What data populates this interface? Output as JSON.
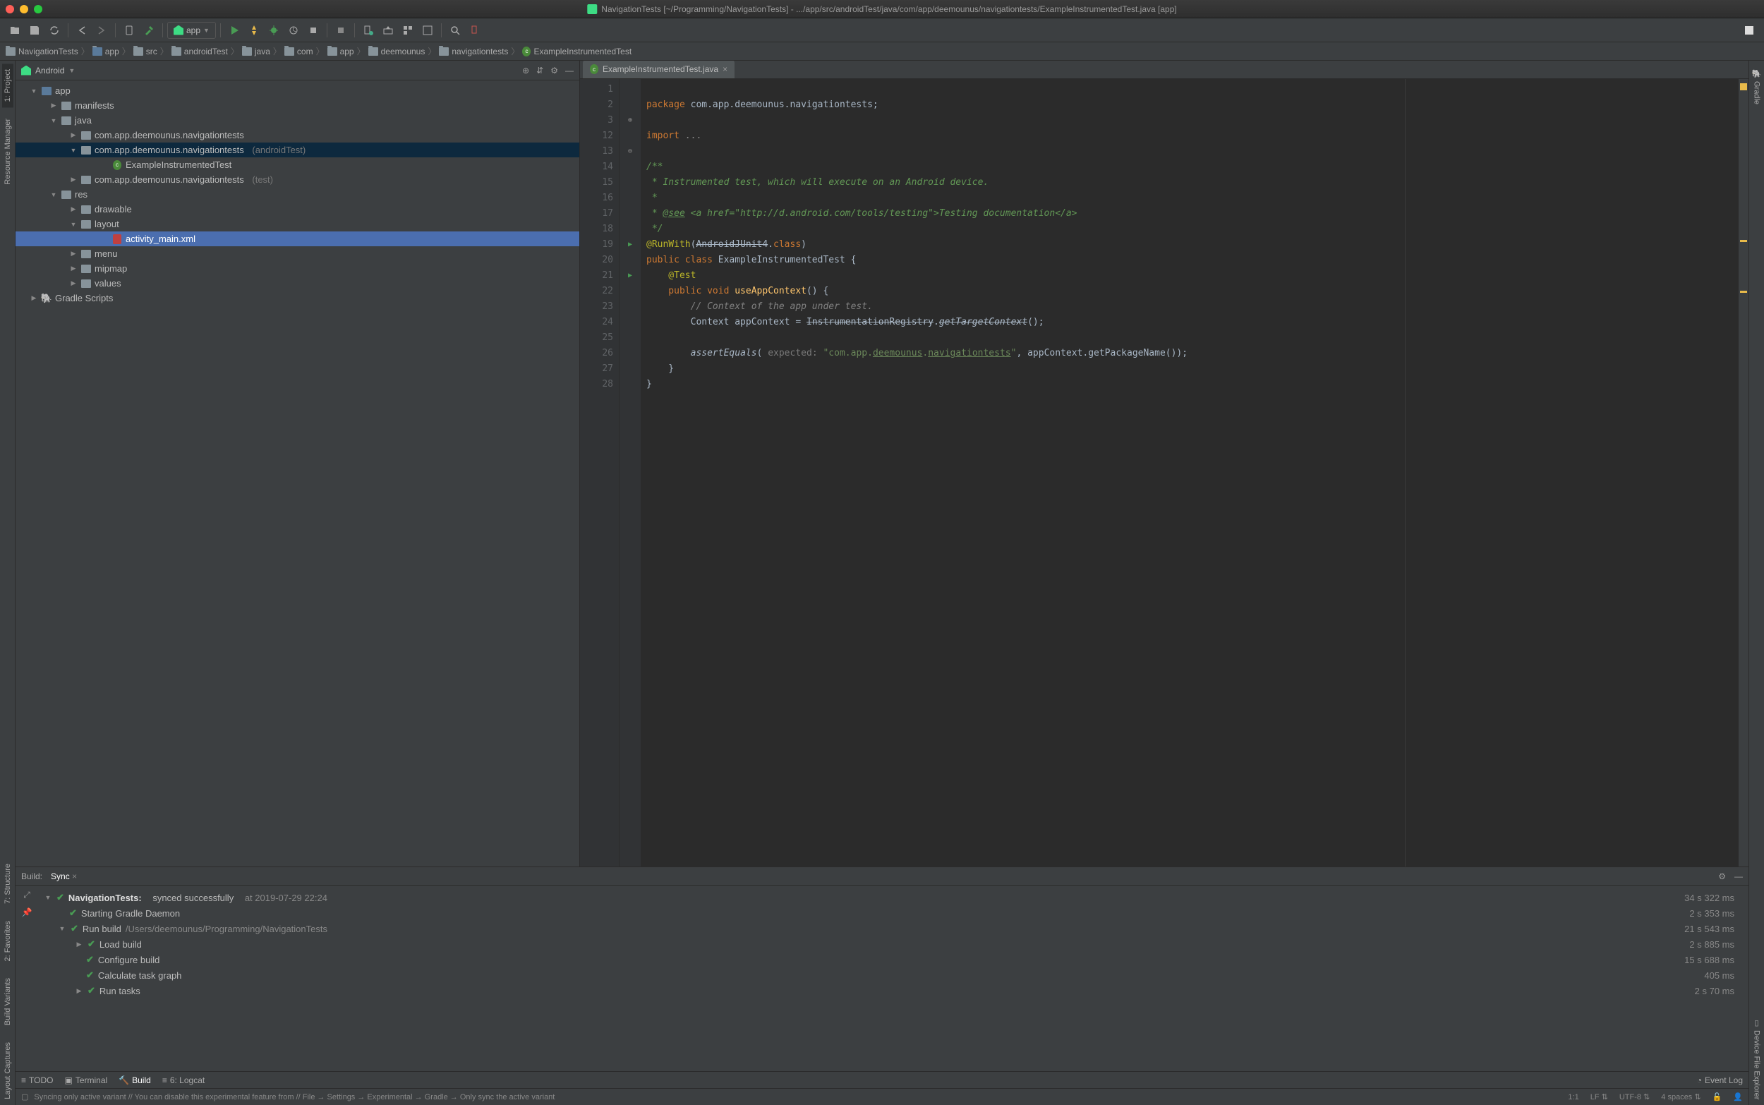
{
  "window": {
    "title": "NavigationTests [~/Programming/NavigationTests] - .../app/src/androidTest/java/com/app/deemounus/navigationtests/ExampleInstrumentedTest.java [app]"
  },
  "runConfig": {
    "label": "app"
  },
  "breadcrumbs": [
    "NavigationTests",
    "app",
    "src",
    "androidTest",
    "java",
    "com",
    "app",
    "deemounus",
    "navigationtests",
    "ExampleInstrumentedTest"
  ],
  "projectHeader": {
    "label": "Android"
  },
  "tree": {
    "root": "app",
    "manifests": "manifests",
    "java": "java",
    "pkg1": "com.app.deemounus.navigationtests",
    "pkg2": "com.app.deemounus.navigationtests",
    "pkg2_suffix": "(androidTest)",
    "example": "ExampleInstrumentedTest",
    "pkg3": "com.app.deemounus.navigationtests",
    "pkg3_suffix": "(test)",
    "res": "res",
    "drawable": "drawable",
    "layout": "layout",
    "activity_main": "activity_main.xml",
    "menu": "menu",
    "mipmap": "mipmap",
    "values": "values",
    "gradle": "Gradle Scripts"
  },
  "editorTab": {
    "label": "ExampleInstrumentedTest.java"
  },
  "lineNumbers": [
    "1",
    "2",
    "3",
    "12",
    "13",
    "14",
    "15",
    "16",
    "17",
    "18",
    "19",
    "20",
    "21",
    "22",
    "23",
    "24",
    "25",
    "26",
    "27",
    "28"
  ],
  "code": {
    "l1_kw": "package",
    "l1_rest": " com.app.deemounus.navigationtests;",
    "l3_kw": "import",
    "l3_rest": " ...",
    "l13": "/**",
    "l14": " * Instrumented test, which will execute on an Android device.",
    "l15": " *",
    "l16_a": " * ",
    "l16_tag": "@see",
    "l16_b": " <a href=\"http://d.android.com/tools/testing\">",
    "l16_c": "Testing documentation",
    "l16_d": "</a>",
    "l17": " */",
    "l18_anno": "@RunWith",
    "l18_paren": "(",
    "l18_cls": "AndroidJUnit4",
    "l18_dot": ".",
    "l18_kw": "class",
    "l18_close": ")",
    "l19_kw": "public class ",
    "l19_cls": "ExampleInstrumentedTest ",
    "l19_brace": "{",
    "l20_anno": "    @Test",
    "l21_kw": "    public void ",
    "l21_method": "useAppContext",
    "l21_rest": "() {",
    "l22": "        // Context of the app under test.",
    "l23_a": "        Context appContext = ",
    "l23_strike": "InstrumentationRegistry",
    "l23_dot": ".",
    "l23_m": "getTargetContext",
    "l23_end": "();",
    "l25_a": "        ",
    "l25_method": "assertEquals",
    "l25_p": "( ",
    "l25_hint": "expected: ",
    "l25_str": "\"com.app.",
    "l25_u1": "deemounus",
    "l25_d1": ".",
    "l25_u2": "navigationtests",
    "l25_strend": "\"",
    "l25_end": ", appContext.getPackageName());",
    "l26": "    }",
    "l27": "}"
  },
  "build": {
    "tab1": "Build:",
    "tab2": "Sync",
    "row1_a": "NavigationTests:",
    "row1_b": "synced successfully",
    "row1_c": "at 2019-07-29 22:24",
    "row1_t": "34 s 322 ms",
    "row2": "Starting Gradle Daemon",
    "row2_t": "2 s 353 ms",
    "row3_a": "Run build ",
    "row3_b": "/Users/deemounus/Programming/NavigationTests",
    "row3_t": "21 s 543 ms",
    "row4": "Load build",
    "row4_t": "2 s 885 ms",
    "row5": "Configure build",
    "row5_t": "15 s 688 ms",
    "row6": "Calculate task graph",
    "row6_t": "405 ms",
    "row7": "Run tasks",
    "row7_t": "2 s 70 ms"
  },
  "bottomTabs": {
    "todo": "TODO",
    "terminal": "Terminal",
    "build": "Build",
    "logcat": "6: Logcat",
    "eventlog": "Event Log"
  },
  "status": {
    "msg": "Syncing only active variant // You can disable this experimental feature from // File → Settings → Experimental → Gradle → Only sync the active variant",
    "pos": "1:1",
    "lf": "LF",
    "enc": "UTF-8",
    "spaces": "4 spaces"
  },
  "leftTabs": {
    "project": "1: Project",
    "rm": "Resource Manager",
    "struct": "7: Structure",
    "fav": "2: Favorites",
    "variants": "Build Variants",
    "captures": "Layout Captures"
  },
  "rightTabs": {
    "gradle": "Gradle",
    "dfe": "Device File Explorer"
  }
}
